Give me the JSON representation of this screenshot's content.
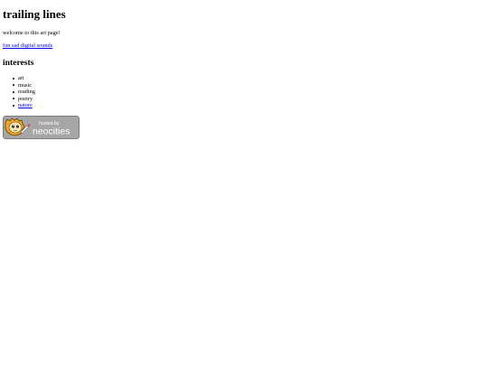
{
  "page": {
    "title": "trailing lines",
    "welcome_text": "welcome to this art page!",
    "music_link_label": "fun sad digital sounds"
  },
  "interests": {
    "heading": "interests",
    "items": [
      {
        "label": "art",
        "link": false
      },
      {
        "label": "music",
        "link": false
      },
      {
        "label": "reading",
        "link": false
      },
      {
        "label": "poetry",
        "link": false
      },
      {
        "label": "nature",
        "link": true
      }
    ]
  },
  "badge": {
    "hosted_by_label": "hosted by",
    "brand_label": "neocities",
    "background_color": "#a6a6a6",
    "mascot_color": "#f4a91f"
  }
}
